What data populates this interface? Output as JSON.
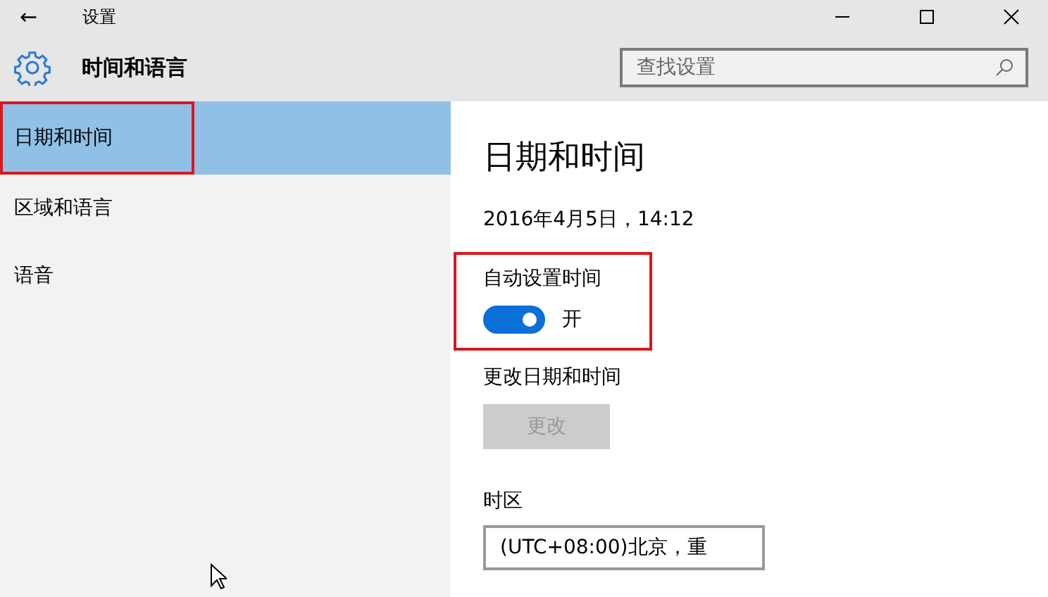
{
  "window": {
    "title": "设置",
    "back": "←"
  },
  "header": {
    "title": "时间和语言"
  },
  "search": {
    "placeholder": "查找设置"
  },
  "sidebar": {
    "items": [
      {
        "label": "日期和时间",
        "selected": true,
        "highlighted": true
      },
      {
        "label": "区域和语言",
        "selected": false,
        "highlighted": false
      },
      {
        "label": "语音",
        "selected": false,
        "highlighted": false
      }
    ]
  },
  "page": {
    "title": "日期和时间",
    "datetime": "2016年4月5日，14:12",
    "auto_time": {
      "label": "自动设置时间",
      "on": true,
      "state_label": "开",
      "highlighted": true
    },
    "change": {
      "label": "更改日期和时间",
      "button": "更改",
      "disabled": true
    },
    "timezone": {
      "label": "时区",
      "value": "(UTC+08:00)北京，重"
    }
  }
}
